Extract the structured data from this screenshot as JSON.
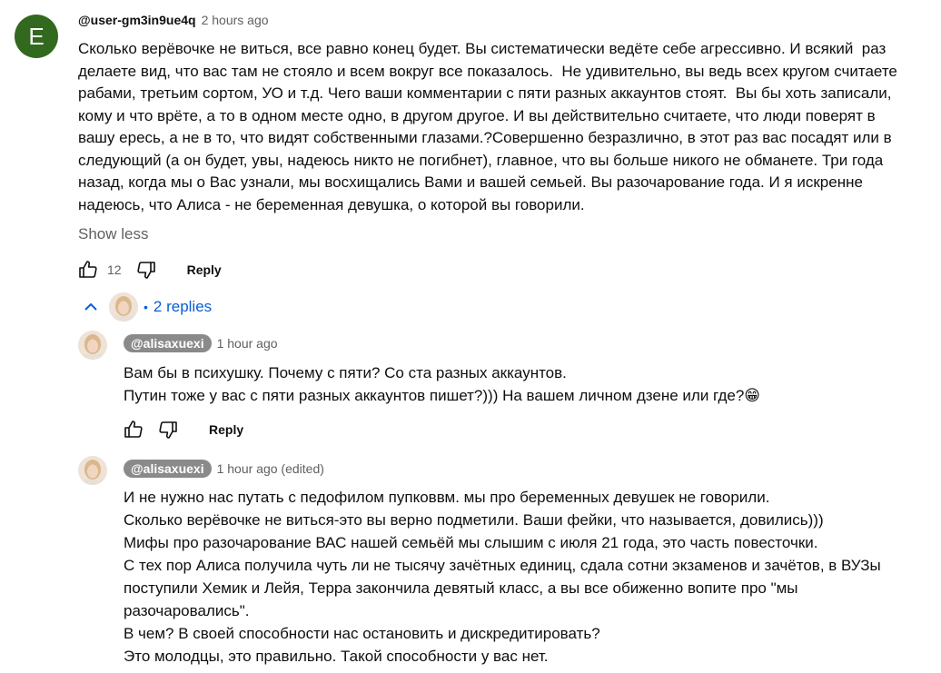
{
  "main_comment": {
    "avatar_letter": "E",
    "author": "@user-gm3in9ue4q",
    "time": "2 hours ago",
    "text": "Сколько верёвочке не виться, все равно конец будет. Вы систематически ведёте себе агрессивно. И всякий  раз\nделаете вид, что вас там не стояло и всем вокруг все показалось.  Не удивительно, вы ведь всех кругом считаете\nрабами, третьим сортом, УО и т.д. Чего ваши комментарии с пяти разных аккаунтов стоят.  Вы бы хоть записали,\nкому и что врёте, а то в одном месте одно, в другом другое. И вы действительно считаете, что люди поверят в\nвашу ересь, а не в то, что видят собственными глазами.?Совершенно безразлично, в этот раз вас посадят или в\nследующий (а он будет, увы, надеюсь никто не погибнет), главное, что вы больше никого не обманете. Три года\nназад, когда мы о Вас узнали, мы восхищались Вами и вашей семьей. Вы разочарование года. И я искренне\nнадеюсь, что Алиса - не беременная девушка, о которой вы говорили.",
    "show_less": "Show less",
    "likes": "12",
    "reply_label": "Reply"
  },
  "replies_toggle": {
    "label": "2 replies",
    "dot": "•"
  },
  "replies": [
    {
      "author": "@alisaxuexi",
      "time": "1 hour ago",
      "text": "Вам бы в психушку. Почему с пяти? Со ста разных аккаунтов.\nПутин тоже у вас с пяти разных аккаунтов пишет?))) На вашем личном дзене или где?😁",
      "reply_label": "Reply"
    },
    {
      "author": "@alisaxuexi",
      "time": "1 hour ago (edited)",
      "text": "И не нужно нас путать с педофилом пупковвм. мы про беременных девушек не говорили.\nСколько верёвочке не виться-это вы верно подметили. Ваши фейки, что называется, довились)))\nМифы про разочарование ВАС нашей семьёй мы слышим с июля 21 года, это часть повесточки.\nС тех пор Алиса получила чуть ли не тысячу зачётных единиц, сдала сотни экзаменов и зачётов, в ВУЗы\nпоступили Хемик и Лейя, Терра закончила девятый класс, а вы все обиженно вопите про \"мы\nразочаровались\".\nВ чем? В своей способности нас остановить и дискредитировать?\nЭто молодцы, это правильно. Такой способности у вас нет."
    }
  ],
  "colors": {
    "avatar_bg": "#33691e",
    "link_blue": "#065fd4",
    "muted": "#606060",
    "badge_bg": "#8a8a8a"
  }
}
